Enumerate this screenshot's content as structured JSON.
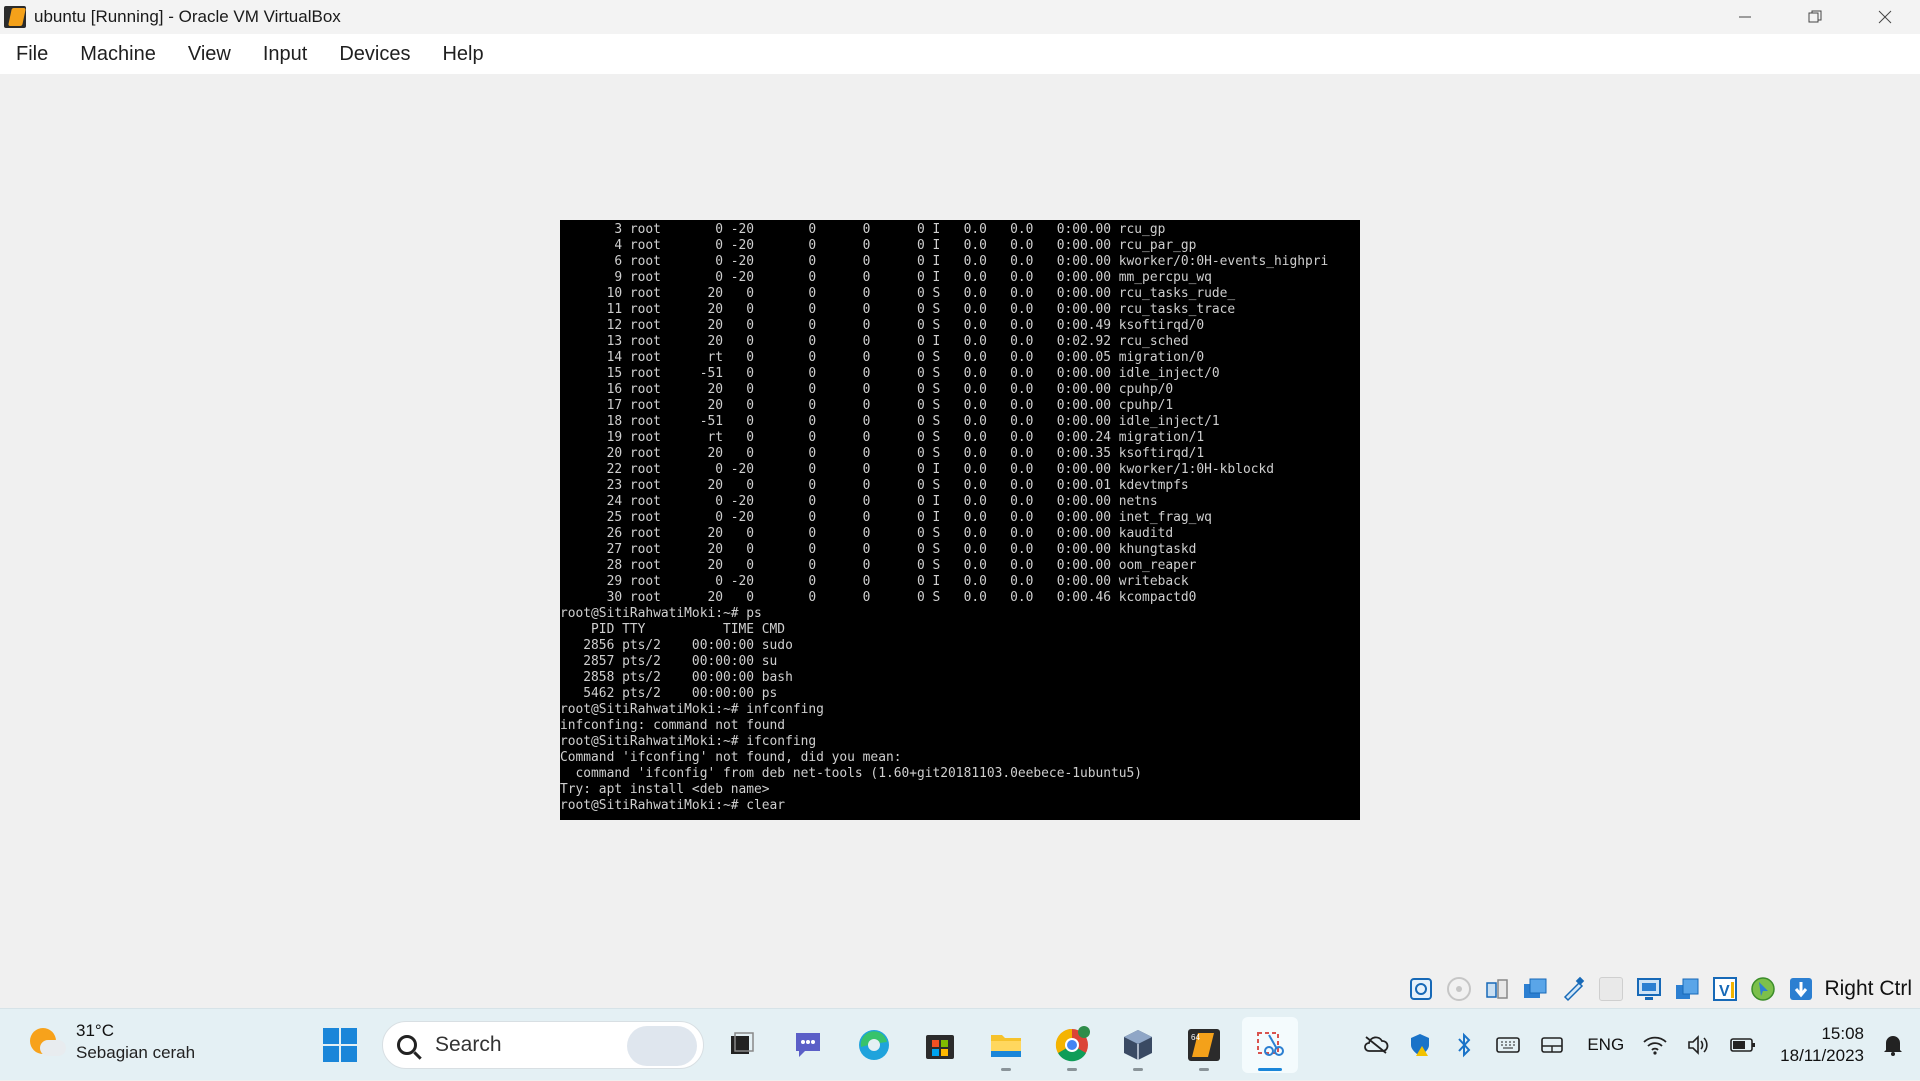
{
  "window": {
    "title": "ubuntu [Running] - Oracle VM VirtualBox",
    "controls": [
      "minimize-icon",
      "restore-icon",
      "close-icon"
    ]
  },
  "menu": [
    "File",
    "Machine",
    "View",
    "Input",
    "Devices",
    "Help"
  ],
  "terminal": {
    "lines": [
      "       3 root       0 -20       0      0      0 I   0.0   0.0   0:00.00 rcu_gp",
      "       4 root       0 -20       0      0      0 I   0.0   0.0   0:00.00 rcu_par_gp",
      "       6 root       0 -20       0      0      0 I   0.0   0.0   0:00.00 kworker/0:0H-events_highpri",
      "       9 root       0 -20       0      0      0 I   0.0   0.0   0:00.00 mm_percpu_wq",
      "      10 root      20   0       0      0      0 S   0.0   0.0   0:00.00 rcu_tasks_rude_",
      "      11 root      20   0       0      0      0 S   0.0   0.0   0:00.00 rcu_tasks_trace",
      "      12 root      20   0       0      0      0 S   0.0   0.0   0:00.49 ksoftirqd/0",
      "      13 root      20   0       0      0      0 I   0.0   0.0   0:02.92 rcu_sched",
      "      14 root      rt   0       0      0      0 S   0.0   0.0   0:00.05 migration/0",
      "      15 root     -51   0       0      0      0 S   0.0   0.0   0:00.00 idle_inject/0",
      "      16 root      20   0       0      0      0 S   0.0   0.0   0:00.00 cpuhp/0",
      "      17 root      20   0       0      0      0 S   0.0   0.0   0:00.00 cpuhp/1",
      "      18 root     -51   0       0      0      0 S   0.0   0.0   0:00.00 idle_inject/1",
      "      19 root      rt   0       0      0      0 S   0.0   0.0   0:00.24 migration/1",
      "      20 root      20   0       0      0      0 S   0.0   0.0   0:00.35 ksoftirqd/1",
      "      22 root       0 -20       0      0      0 I   0.0   0.0   0:00.00 kworker/1:0H-kblockd",
      "      23 root      20   0       0      0      0 S   0.0   0.0   0:00.01 kdevtmpfs",
      "      24 root       0 -20       0      0      0 I   0.0   0.0   0:00.00 netns",
      "      25 root       0 -20       0      0      0 I   0.0   0.0   0:00.00 inet_frag_wq",
      "      26 root      20   0       0      0      0 S   0.0   0.0   0:00.00 kauditd",
      "      27 root      20   0       0      0      0 S   0.0   0.0   0:00.00 khungtaskd",
      "      28 root      20   0       0      0      0 S   0.0   0.0   0:00.00 oom_reaper",
      "      29 root       0 -20       0      0      0 I   0.0   0.0   0:00.00 writeback",
      "      30 root      20   0       0      0      0 S   0.0   0.0   0:00.46 kcompactd0",
      "root@SitiRahwatiMoki:~# ps",
      "    PID TTY          TIME CMD",
      "   2856 pts/2    00:00:00 sudo",
      "   2857 pts/2    00:00:00 su",
      "   2858 pts/2    00:00:00 bash",
      "   5462 pts/2    00:00:00 ps",
      "root@SitiRahwatiMoki:~# infconfing",
      "infconfing: command not found",
      "root@SitiRahwatiMoki:~# ifconfing",
      "Command 'ifconfing' not found, did you mean:",
      "  command 'ifconfig' from deb net-tools (1.60+git20181103.0eebece-1ubuntu5)",
      "Try: apt install <deb name>",
      "root@SitiRahwatiMoki:~# clear"
    ]
  },
  "vbox_status": {
    "icons": [
      "hard-disk-icon",
      "optical-drive-icon",
      "audio-icon",
      "network-icon",
      "usb-icon",
      "shared-folders-icon",
      "display-icon",
      "recording-icon",
      "guest-additions-icon",
      "mouse-integration-icon",
      "keyboard-capture-icon"
    ],
    "host_key": "Right Ctrl"
  },
  "taskbar": {
    "weather_temp": "31°C",
    "weather_desc": "Sebagian cerah",
    "search_label": "Search",
    "apps": [
      "task-view-icon",
      "teams-chat-icon",
      "edge-icon",
      "store-icon",
      "file-explorer-icon",
      "chrome-icon",
      "virtualbox-cube-icon",
      "virtualbox-icon",
      "snipping-tool-icon"
    ],
    "tray_language": "ENG",
    "clock_time": "15:08",
    "clock_date": "18/11/2023"
  },
  "colors": {
    "terminal_bg": "#000000",
    "terminal_fg": "#cfcfcf",
    "taskbar_bg": "#e4f0f4",
    "accent": "#1a86d9"
  }
}
